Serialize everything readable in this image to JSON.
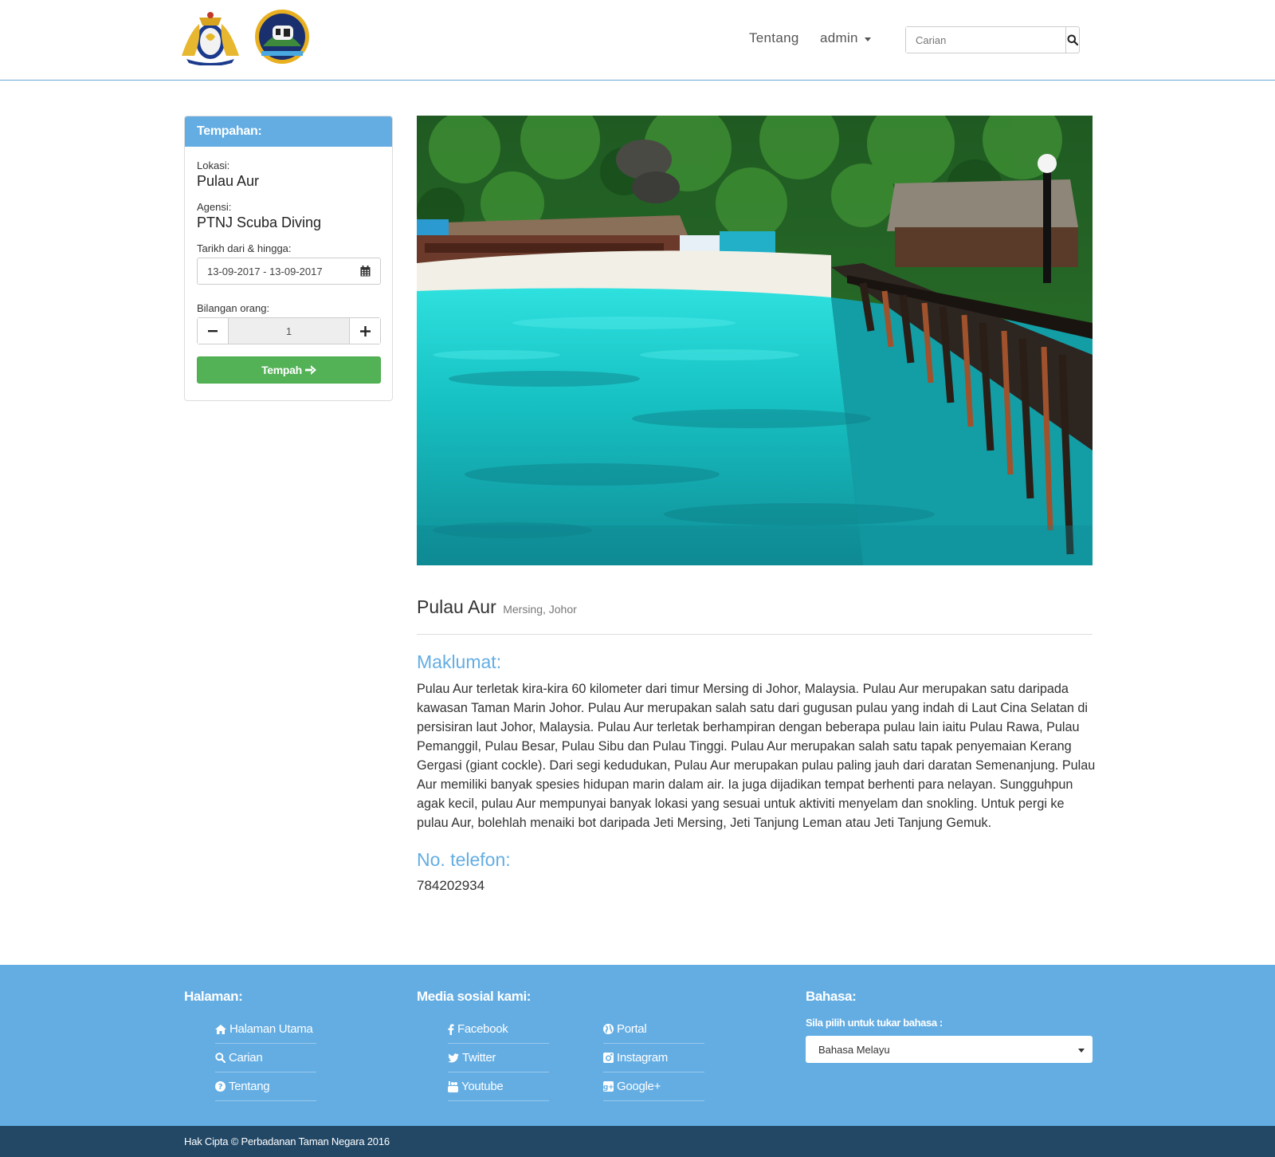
{
  "nav": {
    "about_label": "Tentang",
    "user_label": "admin",
    "search_placeholder": "Carian"
  },
  "booking": {
    "heading": "Tempahan:",
    "location_label": "Lokasi:",
    "location_value": "Pulau Aur",
    "agency_label": "Agensi:",
    "agency_value": "PTNJ Scuba Diving",
    "date_label": "Tarikh dari & hingga:",
    "date_value": "13-09-2017 - 13-09-2017",
    "people_label": "Bilangan orang:",
    "people_value": "1",
    "book_label": "Tempah"
  },
  "place": {
    "name": "Pulau Aur",
    "region": "Mersing, Johor",
    "info_heading": "Maklumat:",
    "description": "Pulau Aur terletak kira-kira 60 kilometer dari timur Mersing di Johor, Malaysia. Pulau Aur merupakan satu daripada kawasan Taman Marin Johor. Pulau Aur merupakan salah satu dari gugusan pulau yang indah di Laut Cina Selatan di persisiran laut Johor, Malaysia. Pulau Aur terletak berhampiran dengan beberapa pulau lain iaitu Pulau Rawa, Pulau Pemanggil, Pulau Besar, Pulau Sibu dan Pulau Tinggi. Pulau Aur merupakan salah satu tapak penyemaian Kerang Gergasi (giant cockle). Dari segi kedudukan, Pulau Aur merupakan pulau paling jauh dari daratan Semenanjung. Pulau Aur memiliki banyak spesies hidupan marin dalam air. Ia juga dijadikan tempat berhenti para nelayan. Sungguhpun agak kecil, pulau Aur mempunyai banyak lokasi yang sesuai untuk aktiviti menyelam dan snokling. Untuk pergi ke pulau Aur, bolehlah menaiki bot daripada Jeti Mersing, Jeti Tanjung Leman atau Jeti Tanjung Gemuk.",
    "phone_heading": "No. telefon:",
    "phone_value": "784202934"
  },
  "footer": {
    "pages_heading": "Halaman:",
    "pages": [
      {
        "label": "Halaman Utama",
        "icon": "home-icon"
      },
      {
        "label": "Carian",
        "icon": "search-icon"
      },
      {
        "label": "Tentang",
        "icon": "question-circle-icon"
      }
    ],
    "social_heading": "Media sosial kami:",
    "social_left": [
      {
        "label": "Facebook",
        "icon": "facebook-icon"
      },
      {
        "label": "Twitter",
        "icon": "twitter-icon"
      },
      {
        "label": "Youtube",
        "icon": "youtube-icon"
      }
    ],
    "social_right": [
      {
        "label": "Portal",
        "icon": "globe-icon"
      },
      {
        "label": "Instagram",
        "icon": "instagram-icon"
      },
      {
        "label": "Google+",
        "icon": "google-plus-icon"
      }
    ],
    "lang_heading": "Bahasa:",
    "lang_label": "Sila pilih untuk tukar bahasa :",
    "lang_selected": "Bahasa Melayu",
    "copyright": "Hak Cipta © Perbadanan Taman Negara 2016"
  },
  "colors": {
    "accent": "#63ade3",
    "success": "#53b156",
    "dark_bar": "#234866"
  }
}
